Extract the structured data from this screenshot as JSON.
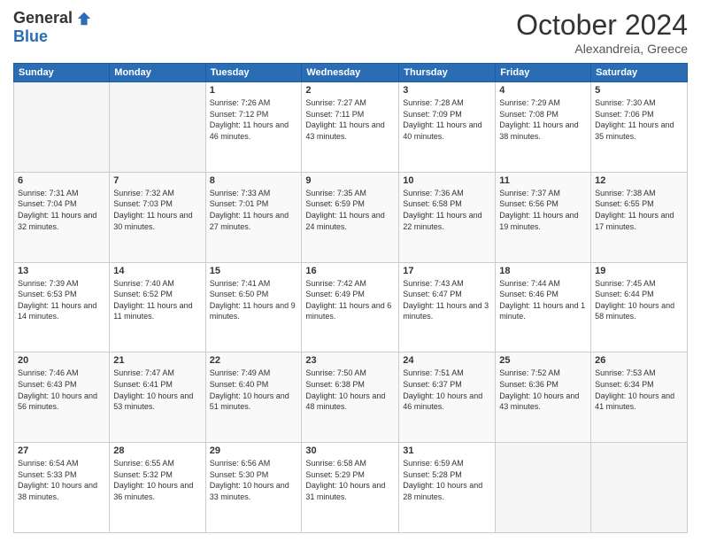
{
  "header": {
    "logo_general": "General",
    "logo_blue": "Blue",
    "month": "October 2024",
    "location": "Alexandreia, Greece"
  },
  "weekdays": [
    "Sunday",
    "Monday",
    "Tuesday",
    "Wednesday",
    "Thursday",
    "Friday",
    "Saturday"
  ],
  "weeks": [
    [
      {
        "day": "",
        "sunrise": "",
        "sunset": "",
        "daylight": ""
      },
      {
        "day": "",
        "sunrise": "",
        "sunset": "",
        "daylight": ""
      },
      {
        "day": "1",
        "sunrise": "Sunrise: 7:26 AM",
        "sunset": "Sunset: 7:12 PM",
        "daylight": "Daylight: 11 hours and 46 minutes."
      },
      {
        "day": "2",
        "sunrise": "Sunrise: 7:27 AM",
        "sunset": "Sunset: 7:11 PM",
        "daylight": "Daylight: 11 hours and 43 minutes."
      },
      {
        "day": "3",
        "sunrise": "Sunrise: 7:28 AM",
        "sunset": "Sunset: 7:09 PM",
        "daylight": "Daylight: 11 hours and 40 minutes."
      },
      {
        "day": "4",
        "sunrise": "Sunrise: 7:29 AM",
        "sunset": "Sunset: 7:08 PM",
        "daylight": "Daylight: 11 hours and 38 minutes."
      },
      {
        "day": "5",
        "sunrise": "Sunrise: 7:30 AM",
        "sunset": "Sunset: 7:06 PM",
        "daylight": "Daylight: 11 hours and 35 minutes."
      }
    ],
    [
      {
        "day": "6",
        "sunrise": "Sunrise: 7:31 AM",
        "sunset": "Sunset: 7:04 PM",
        "daylight": "Daylight: 11 hours and 32 minutes."
      },
      {
        "day": "7",
        "sunrise": "Sunrise: 7:32 AM",
        "sunset": "Sunset: 7:03 PM",
        "daylight": "Daylight: 11 hours and 30 minutes."
      },
      {
        "day": "8",
        "sunrise": "Sunrise: 7:33 AM",
        "sunset": "Sunset: 7:01 PM",
        "daylight": "Daylight: 11 hours and 27 minutes."
      },
      {
        "day": "9",
        "sunrise": "Sunrise: 7:35 AM",
        "sunset": "Sunset: 6:59 PM",
        "daylight": "Daylight: 11 hours and 24 minutes."
      },
      {
        "day": "10",
        "sunrise": "Sunrise: 7:36 AM",
        "sunset": "Sunset: 6:58 PM",
        "daylight": "Daylight: 11 hours and 22 minutes."
      },
      {
        "day": "11",
        "sunrise": "Sunrise: 7:37 AM",
        "sunset": "Sunset: 6:56 PM",
        "daylight": "Daylight: 11 hours and 19 minutes."
      },
      {
        "day": "12",
        "sunrise": "Sunrise: 7:38 AM",
        "sunset": "Sunset: 6:55 PM",
        "daylight": "Daylight: 11 hours and 17 minutes."
      }
    ],
    [
      {
        "day": "13",
        "sunrise": "Sunrise: 7:39 AM",
        "sunset": "Sunset: 6:53 PM",
        "daylight": "Daylight: 11 hours and 14 minutes."
      },
      {
        "day": "14",
        "sunrise": "Sunrise: 7:40 AM",
        "sunset": "Sunset: 6:52 PM",
        "daylight": "Daylight: 11 hours and 11 minutes."
      },
      {
        "day": "15",
        "sunrise": "Sunrise: 7:41 AM",
        "sunset": "Sunset: 6:50 PM",
        "daylight": "Daylight: 11 hours and 9 minutes."
      },
      {
        "day": "16",
        "sunrise": "Sunrise: 7:42 AM",
        "sunset": "Sunset: 6:49 PM",
        "daylight": "Daylight: 11 hours and 6 minutes."
      },
      {
        "day": "17",
        "sunrise": "Sunrise: 7:43 AM",
        "sunset": "Sunset: 6:47 PM",
        "daylight": "Daylight: 11 hours and 3 minutes."
      },
      {
        "day": "18",
        "sunrise": "Sunrise: 7:44 AM",
        "sunset": "Sunset: 6:46 PM",
        "daylight": "Daylight: 11 hours and 1 minute."
      },
      {
        "day": "19",
        "sunrise": "Sunrise: 7:45 AM",
        "sunset": "Sunset: 6:44 PM",
        "daylight": "Daylight: 10 hours and 58 minutes."
      }
    ],
    [
      {
        "day": "20",
        "sunrise": "Sunrise: 7:46 AM",
        "sunset": "Sunset: 6:43 PM",
        "daylight": "Daylight: 10 hours and 56 minutes."
      },
      {
        "day": "21",
        "sunrise": "Sunrise: 7:47 AM",
        "sunset": "Sunset: 6:41 PM",
        "daylight": "Daylight: 10 hours and 53 minutes."
      },
      {
        "day": "22",
        "sunrise": "Sunrise: 7:49 AM",
        "sunset": "Sunset: 6:40 PM",
        "daylight": "Daylight: 10 hours and 51 minutes."
      },
      {
        "day": "23",
        "sunrise": "Sunrise: 7:50 AM",
        "sunset": "Sunset: 6:38 PM",
        "daylight": "Daylight: 10 hours and 48 minutes."
      },
      {
        "day": "24",
        "sunrise": "Sunrise: 7:51 AM",
        "sunset": "Sunset: 6:37 PM",
        "daylight": "Daylight: 10 hours and 46 minutes."
      },
      {
        "day": "25",
        "sunrise": "Sunrise: 7:52 AM",
        "sunset": "Sunset: 6:36 PM",
        "daylight": "Daylight: 10 hours and 43 minutes."
      },
      {
        "day": "26",
        "sunrise": "Sunrise: 7:53 AM",
        "sunset": "Sunset: 6:34 PM",
        "daylight": "Daylight: 10 hours and 41 minutes."
      }
    ],
    [
      {
        "day": "27",
        "sunrise": "Sunrise: 6:54 AM",
        "sunset": "Sunset: 5:33 PM",
        "daylight": "Daylight: 10 hours and 38 minutes."
      },
      {
        "day": "28",
        "sunrise": "Sunrise: 6:55 AM",
        "sunset": "Sunset: 5:32 PM",
        "daylight": "Daylight: 10 hours and 36 minutes."
      },
      {
        "day": "29",
        "sunrise": "Sunrise: 6:56 AM",
        "sunset": "Sunset: 5:30 PM",
        "daylight": "Daylight: 10 hours and 33 minutes."
      },
      {
        "day": "30",
        "sunrise": "Sunrise: 6:58 AM",
        "sunset": "Sunset: 5:29 PM",
        "daylight": "Daylight: 10 hours and 31 minutes."
      },
      {
        "day": "31",
        "sunrise": "Sunrise: 6:59 AM",
        "sunset": "Sunset: 5:28 PM",
        "daylight": "Daylight: 10 hours and 28 minutes."
      },
      {
        "day": "",
        "sunrise": "",
        "sunset": "",
        "daylight": ""
      },
      {
        "day": "",
        "sunrise": "",
        "sunset": "",
        "daylight": ""
      }
    ]
  ]
}
